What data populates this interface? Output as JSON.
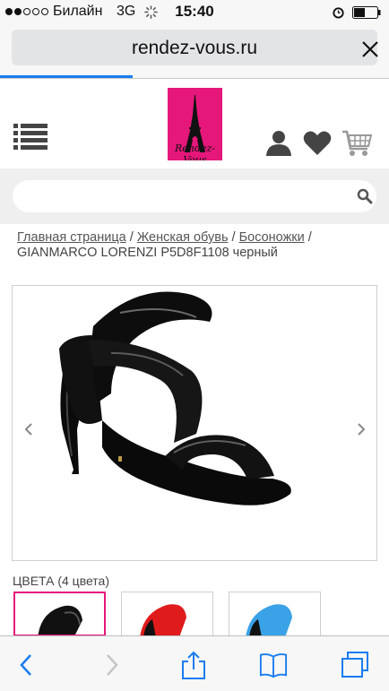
{
  "status_bar": {
    "carrier": "Билайн",
    "network": "3G",
    "time": "15:40",
    "signal_bars": 2
  },
  "browser": {
    "url": "rendez-vous.ru",
    "load_progress": 0.34
  },
  "header": {
    "logo_text": "Rendez-Vous",
    "icons": [
      "menu-icon",
      "user-icon",
      "heart-icon",
      "cart-icon"
    ]
  },
  "search": {
    "placeholder": "",
    "icon": "search-icon"
  },
  "breadcrumb": {
    "items": [
      "Главная страница",
      "Женская обувь",
      "Босоножки"
    ],
    "current": "GIANMARCO LORENZI P5D8F1108 черный"
  },
  "product": {
    "image_alt": "black patent sandal"
  },
  "colors": {
    "title": "ЦВЕТА (4 цвета)",
    "swatches": [
      {
        "color": "#111111",
        "selected": true
      },
      {
        "color": "#e01b1b",
        "selected": false
      },
      {
        "color": "#3aa2e6",
        "selected": false
      }
    ]
  },
  "toolbar": {
    "icons": [
      "back-icon",
      "forward-icon",
      "share-icon",
      "bookmarks-icon",
      "tabs-icon"
    ]
  },
  "theme": {
    "accent": "#1a7cf0",
    "brand": "#e6177a"
  }
}
